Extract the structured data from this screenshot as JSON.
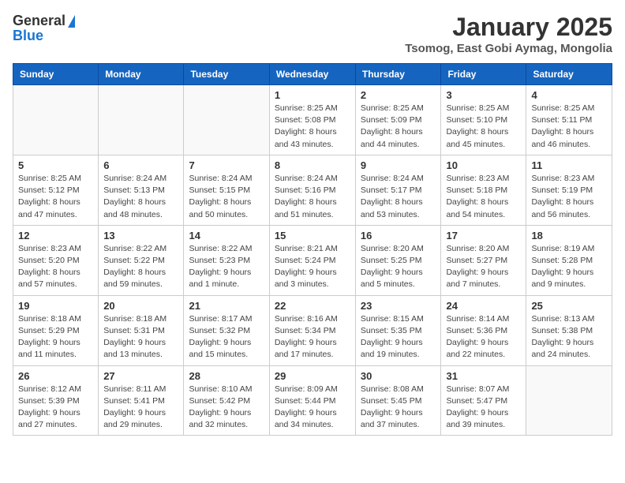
{
  "header": {
    "logo_general": "General",
    "logo_blue": "Blue",
    "month_title": "January 2025",
    "subtitle": "Tsomog, East Gobi Aymag, Mongolia"
  },
  "weekdays": [
    "Sunday",
    "Monday",
    "Tuesday",
    "Wednesday",
    "Thursday",
    "Friday",
    "Saturday"
  ],
  "weeks": [
    [
      {
        "day": "",
        "sunrise": "",
        "sunset": "",
        "daylight": ""
      },
      {
        "day": "",
        "sunrise": "",
        "sunset": "",
        "daylight": ""
      },
      {
        "day": "",
        "sunrise": "",
        "sunset": "",
        "daylight": ""
      },
      {
        "day": "1",
        "sunrise": "Sunrise: 8:25 AM",
        "sunset": "Sunset: 5:08 PM",
        "daylight": "Daylight: 8 hours and 43 minutes."
      },
      {
        "day": "2",
        "sunrise": "Sunrise: 8:25 AM",
        "sunset": "Sunset: 5:09 PM",
        "daylight": "Daylight: 8 hours and 44 minutes."
      },
      {
        "day": "3",
        "sunrise": "Sunrise: 8:25 AM",
        "sunset": "Sunset: 5:10 PM",
        "daylight": "Daylight: 8 hours and 45 minutes."
      },
      {
        "day": "4",
        "sunrise": "Sunrise: 8:25 AM",
        "sunset": "Sunset: 5:11 PM",
        "daylight": "Daylight: 8 hours and 46 minutes."
      }
    ],
    [
      {
        "day": "5",
        "sunrise": "Sunrise: 8:25 AM",
        "sunset": "Sunset: 5:12 PM",
        "daylight": "Daylight: 8 hours and 47 minutes."
      },
      {
        "day": "6",
        "sunrise": "Sunrise: 8:24 AM",
        "sunset": "Sunset: 5:13 PM",
        "daylight": "Daylight: 8 hours and 48 minutes."
      },
      {
        "day": "7",
        "sunrise": "Sunrise: 8:24 AM",
        "sunset": "Sunset: 5:15 PM",
        "daylight": "Daylight: 8 hours and 50 minutes."
      },
      {
        "day": "8",
        "sunrise": "Sunrise: 8:24 AM",
        "sunset": "Sunset: 5:16 PM",
        "daylight": "Daylight: 8 hours and 51 minutes."
      },
      {
        "day": "9",
        "sunrise": "Sunrise: 8:24 AM",
        "sunset": "Sunset: 5:17 PM",
        "daylight": "Daylight: 8 hours and 53 minutes."
      },
      {
        "day": "10",
        "sunrise": "Sunrise: 8:23 AM",
        "sunset": "Sunset: 5:18 PM",
        "daylight": "Daylight: 8 hours and 54 minutes."
      },
      {
        "day": "11",
        "sunrise": "Sunrise: 8:23 AM",
        "sunset": "Sunset: 5:19 PM",
        "daylight": "Daylight: 8 hours and 56 minutes."
      }
    ],
    [
      {
        "day": "12",
        "sunrise": "Sunrise: 8:23 AM",
        "sunset": "Sunset: 5:20 PM",
        "daylight": "Daylight: 8 hours and 57 minutes."
      },
      {
        "day": "13",
        "sunrise": "Sunrise: 8:22 AM",
        "sunset": "Sunset: 5:22 PM",
        "daylight": "Daylight: 8 hours and 59 minutes."
      },
      {
        "day": "14",
        "sunrise": "Sunrise: 8:22 AM",
        "sunset": "Sunset: 5:23 PM",
        "daylight": "Daylight: 9 hours and 1 minute."
      },
      {
        "day": "15",
        "sunrise": "Sunrise: 8:21 AM",
        "sunset": "Sunset: 5:24 PM",
        "daylight": "Daylight: 9 hours and 3 minutes."
      },
      {
        "day": "16",
        "sunrise": "Sunrise: 8:20 AM",
        "sunset": "Sunset: 5:25 PM",
        "daylight": "Daylight: 9 hours and 5 minutes."
      },
      {
        "day": "17",
        "sunrise": "Sunrise: 8:20 AM",
        "sunset": "Sunset: 5:27 PM",
        "daylight": "Daylight: 9 hours and 7 minutes."
      },
      {
        "day": "18",
        "sunrise": "Sunrise: 8:19 AM",
        "sunset": "Sunset: 5:28 PM",
        "daylight": "Daylight: 9 hours and 9 minutes."
      }
    ],
    [
      {
        "day": "19",
        "sunrise": "Sunrise: 8:18 AM",
        "sunset": "Sunset: 5:29 PM",
        "daylight": "Daylight: 9 hours and 11 minutes."
      },
      {
        "day": "20",
        "sunrise": "Sunrise: 8:18 AM",
        "sunset": "Sunset: 5:31 PM",
        "daylight": "Daylight: 9 hours and 13 minutes."
      },
      {
        "day": "21",
        "sunrise": "Sunrise: 8:17 AM",
        "sunset": "Sunset: 5:32 PM",
        "daylight": "Daylight: 9 hours and 15 minutes."
      },
      {
        "day": "22",
        "sunrise": "Sunrise: 8:16 AM",
        "sunset": "Sunset: 5:34 PM",
        "daylight": "Daylight: 9 hours and 17 minutes."
      },
      {
        "day": "23",
        "sunrise": "Sunrise: 8:15 AM",
        "sunset": "Sunset: 5:35 PM",
        "daylight": "Daylight: 9 hours and 19 minutes."
      },
      {
        "day": "24",
        "sunrise": "Sunrise: 8:14 AM",
        "sunset": "Sunset: 5:36 PM",
        "daylight": "Daylight: 9 hours and 22 minutes."
      },
      {
        "day": "25",
        "sunrise": "Sunrise: 8:13 AM",
        "sunset": "Sunset: 5:38 PM",
        "daylight": "Daylight: 9 hours and 24 minutes."
      }
    ],
    [
      {
        "day": "26",
        "sunrise": "Sunrise: 8:12 AM",
        "sunset": "Sunset: 5:39 PM",
        "daylight": "Daylight: 9 hours and 27 minutes."
      },
      {
        "day": "27",
        "sunrise": "Sunrise: 8:11 AM",
        "sunset": "Sunset: 5:41 PM",
        "daylight": "Daylight: 9 hours and 29 minutes."
      },
      {
        "day": "28",
        "sunrise": "Sunrise: 8:10 AM",
        "sunset": "Sunset: 5:42 PM",
        "daylight": "Daylight: 9 hours and 32 minutes."
      },
      {
        "day": "29",
        "sunrise": "Sunrise: 8:09 AM",
        "sunset": "Sunset: 5:44 PM",
        "daylight": "Daylight: 9 hours and 34 minutes."
      },
      {
        "day": "30",
        "sunrise": "Sunrise: 8:08 AM",
        "sunset": "Sunset: 5:45 PM",
        "daylight": "Daylight: 9 hours and 37 minutes."
      },
      {
        "day": "31",
        "sunrise": "Sunrise: 8:07 AM",
        "sunset": "Sunset: 5:47 PM",
        "daylight": "Daylight: 9 hours and 39 minutes."
      },
      {
        "day": "",
        "sunrise": "",
        "sunset": "",
        "daylight": ""
      }
    ]
  ]
}
